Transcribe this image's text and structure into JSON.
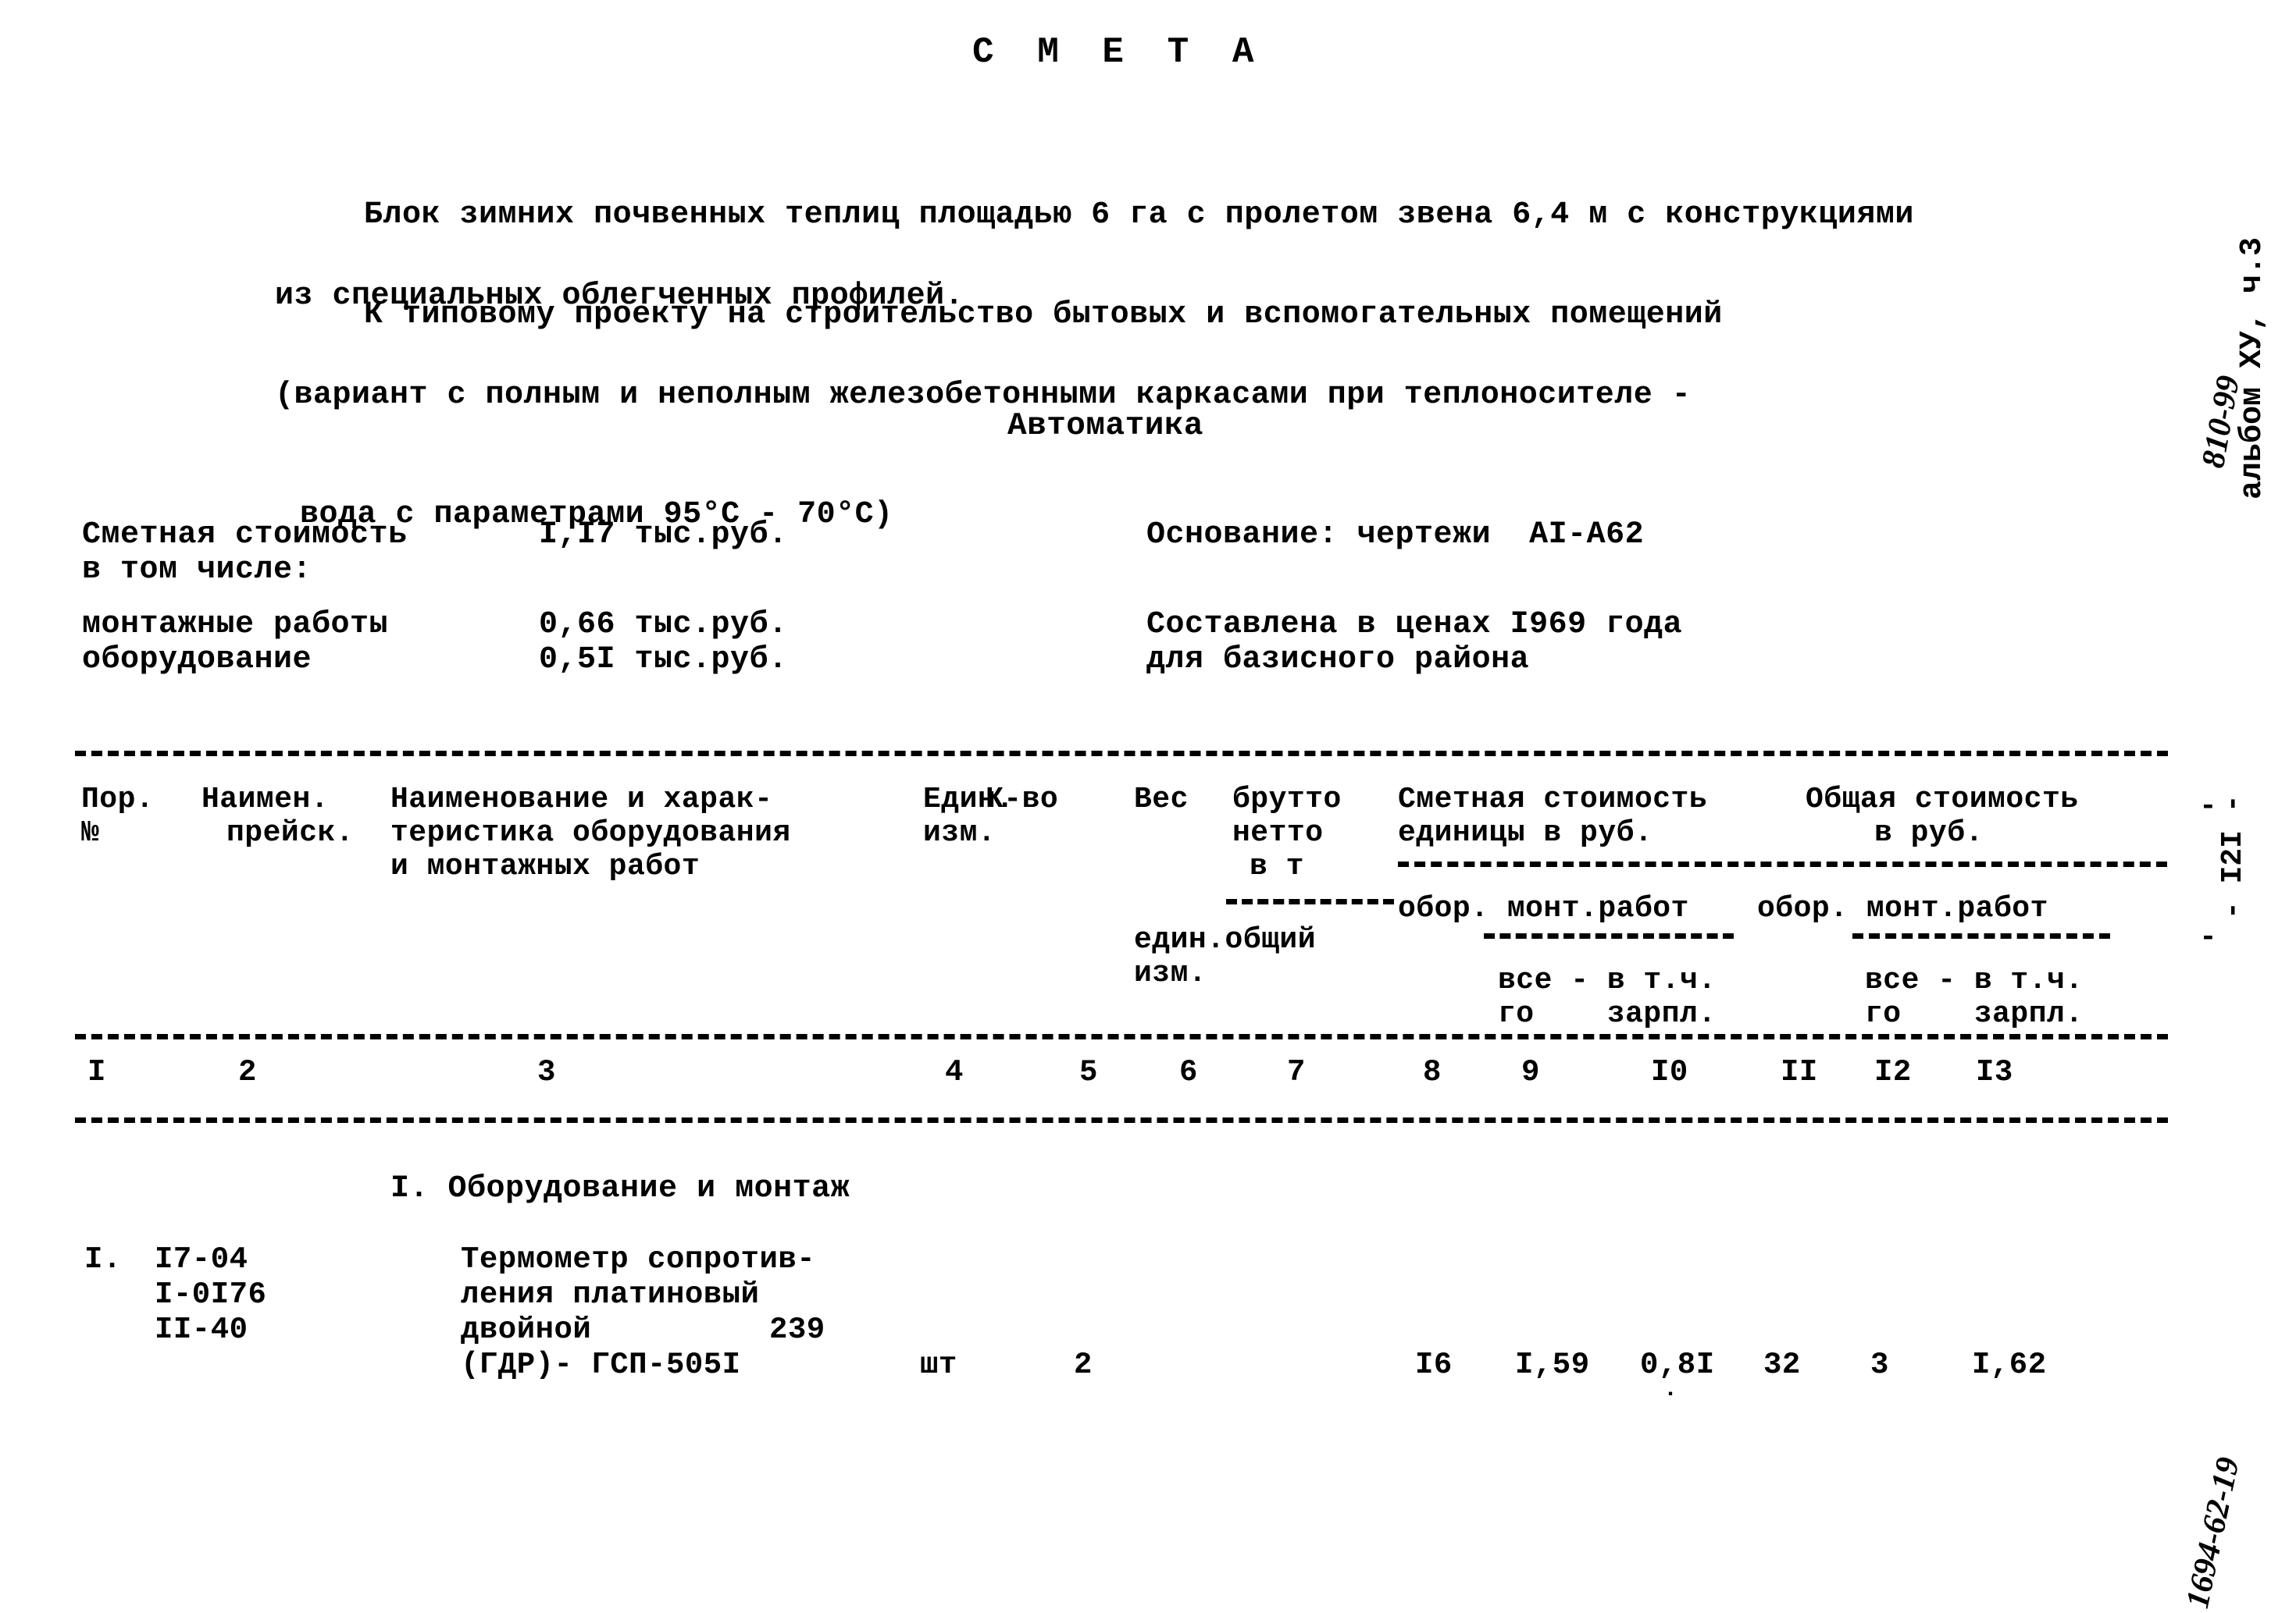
{
  "document": {
    "title": "С М Е Т А",
    "intro_1_line1": "Блок зимних почвенных теплиц площадью 6 га с пролетом звена 6,4 м с конструкциями",
    "intro_1_line2": "из специальных облегченных профилей.",
    "intro_2_line1": "К типовому проекту на строительство бытовых и вспомогательных помещений",
    "intro_2_line2": "(вариант с полным и неполным железобетонными каркасами при теплоносителе -",
    "intro_2_line3": "вода с параметрами 95°С - 70°С)",
    "section_heading": "Автоматика"
  },
  "summary": {
    "total_label": "Сметная стоимость",
    "total_sub_label": "в том числе:",
    "total_value": "I,I7 тыс.руб.",
    "installation_label": "монтажные работы",
    "installation_value": "0,66 тыс.руб.",
    "equipment_label": "оборудование",
    "equipment_value": "0,5I тыс.руб."
  },
  "basis": {
    "drawings": "Основание: чертежи  АI-А62",
    "prices_line1": "Составлена в ценах I969 года",
    "prices_line2": "для базисного района"
  },
  "table": {
    "header": {
      "c1_line1": "Пор.",
      "c1_line2": "№",
      "c2_line1": "Наимен.",
      "c2_line2": "прейск.",
      "c3_line1": "Наименование и харак-",
      "c3_line2": "теристика оборудования",
      "c3_line3": "и монтажных работ",
      "c4_line1": "Един.",
      "c4_line2": "изм.",
      "c5_line1": "К-во",
      "c6_line1": "Вес",
      "c7_line1": "брутто",
      "c7_line2": "нетто",
      "c7_line3": "в т",
      "c7_line4": "един.общий",
      "c7_line5": "изм.",
      "c8_line1": "Сметная стоимость",
      "c8_line2": "единицы в руб.",
      "c9_line1": "Общая стоимость",
      "c9_line2": "в руб.",
      "sub_equip_left": "обор. монт.работ",
      "sub_equip_right": "обор. монт.работ",
      "sub_all_left_1": "все - в т.ч.",
      "sub_all_left_2": "го    зарпл.",
      "sub_all_right_1": "все - в т.ч.",
      "sub_all_right_2": "го    зарпл."
    },
    "column_numbers": [
      "I",
      "2",
      "3",
      "4",
      "5",
      "6",
      "7",
      "8",
      "9",
      "I0",
      "II",
      "I2",
      "I3"
    ],
    "section_label": "I. Оборудование и монтаж",
    "rows": [
      {
        "position": "I.",
        "price_ref_1": "I7-04",
        "price_ref_2": "I-0I76",
        "price_ref_3": "II-40",
        "desc_1": "Термометр сопротив-",
        "desc_2": "ления платиновый",
        "desc_3": "двойной",
        "desc_3_number": "239",
        "desc_4": "(ГДР)- ГСП-505I",
        "unit": "шт",
        "qty": "2",
        "weight_gross": "",
        "weight_net": "",
        "unit_cost_equip": "I6",
        "unit_cost_install_all": "I,59",
        "unit_cost_install_salary": "0,8I",
        "total_cost_equip": "32",
        "total_cost_install_all": "3",
        "total_cost_install_salary": "I,62"
      }
    ]
  },
  "margins": {
    "album": "альбом ХУ, ч.3",
    "album_code": "810-99",
    "page_number": "- I2I -",
    "bottom_code": "1694-62-19"
  }
}
